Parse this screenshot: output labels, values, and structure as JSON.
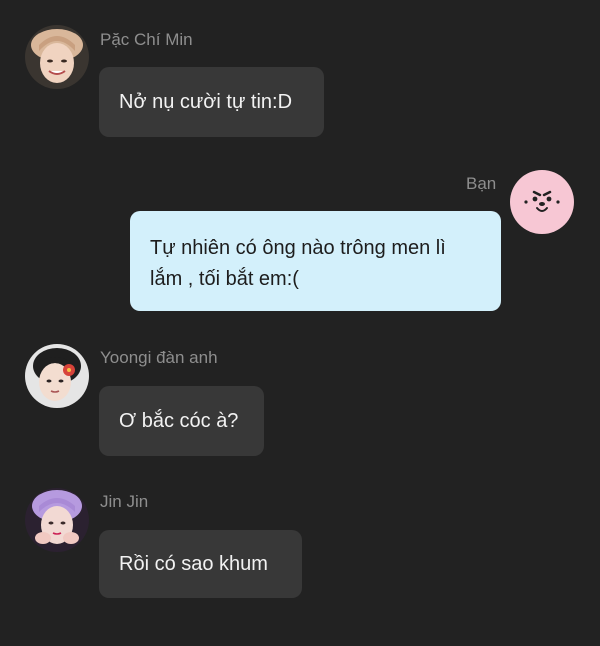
{
  "messages": [
    {
      "sender": "Pặc Chí Min",
      "text": "Nở nụ cười tự tin:D",
      "avatar_icon": "avatar-jimin-icon"
    },
    {
      "sender": "Bạn",
      "text": "Tự nhiên có ông nào trông men lì lắm , tối bắt em:(",
      "avatar_icon": "cooky-bunny-icon"
    },
    {
      "sender": "Yoongi đàn anh",
      "text": "Ơ bắc cóc à?",
      "avatar_icon": "avatar-yoongi-icon"
    },
    {
      "sender": "Jin Jin",
      "text": "Rồi có sao khum",
      "avatar_icon": "avatar-jin-icon"
    }
  ],
  "colors": {
    "background": "#222222",
    "incoming_bubble": "#383838",
    "outgoing_bubble": "#d3f0fb",
    "sender_name": "#8e8e8e",
    "cooky_pink": "#f7c7d4"
  }
}
